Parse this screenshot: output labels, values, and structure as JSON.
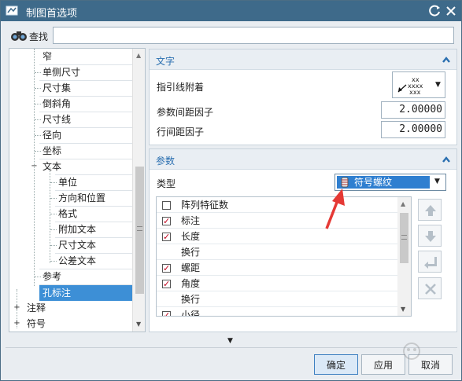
{
  "window": {
    "title": "制图首选项"
  },
  "find": {
    "label": "查找",
    "value": ""
  },
  "tree": {
    "items": [
      {
        "label": "窄"
      },
      {
        "label": "单侧尺寸"
      },
      {
        "label": "尺寸集"
      },
      {
        "label": "倒斜角"
      },
      {
        "label": "尺寸线"
      },
      {
        "label": "径向"
      },
      {
        "label": "坐标"
      },
      {
        "label": "文本",
        "expander": "−"
      },
      {
        "label": "单位"
      },
      {
        "label": "方向和位置"
      },
      {
        "label": "格式"
      },
      {
        "label": "附加文本"
      },
      {
        "label": "尺寸文本"
      },
      {
        "label": "公差文本"
      },
      {
        "label": "参考"
      },
      {
        "label": "孔标注",
        "selected": true
      },
      {
        "label": "注释",
        "expander": "+"
      },
      {
        "label": "符号",
        "expander": "+"
      }
    ]
  },
  "text_section": {
    "title": "文字",
    "leader_label": "指引线附着",
    "leader_glyph_icon": "leader-attach-icon",
    "param_spacing_label": "参数间距因子",
    "param_spacing_value": "2.00000",
    "line_spacing_label": "行间距因子",
    "line_spacing_value": "2.00000"
  },
  "param_section": {
    "title": "参数",
    "type_label": "类型",
    "type_value": "符号螺纹",
    "type_icon": "thread-symbol-icon",
    "list": [
      {
        "label": "阵列特征数",
        "checked": false
      },
      {
        "label": "标注",
        "checked": true
      },
      {
        "label": "长度",
        "checked": true
      },
      {
        "label": "换行",
        "checked": null
      },
      {
        "label": "螺距",
        "checked": true
      },
      {
        "label": "角度",
        "checked": true
      },
      {
        "label": "换行",
        "checked": null
      },
      {
        "label": "小径",
        "checked": true
      }
    ],
    "side_buttons": [
      "move-up-icon",
      "move-down-icon",
      "insert-return-icon",
      "delete-icon"
    ]
  },
  "buttons": {
    "ok": "确定",
    "apply": "应用",
    "cancel": "取消"
  },
  "colors": {
    "titlebar": "#3e6a8a",
    "accent": "#2a6fb0",
    "selection": "#3d8fd6",
    "annotation": "#e53935"
  }
}
